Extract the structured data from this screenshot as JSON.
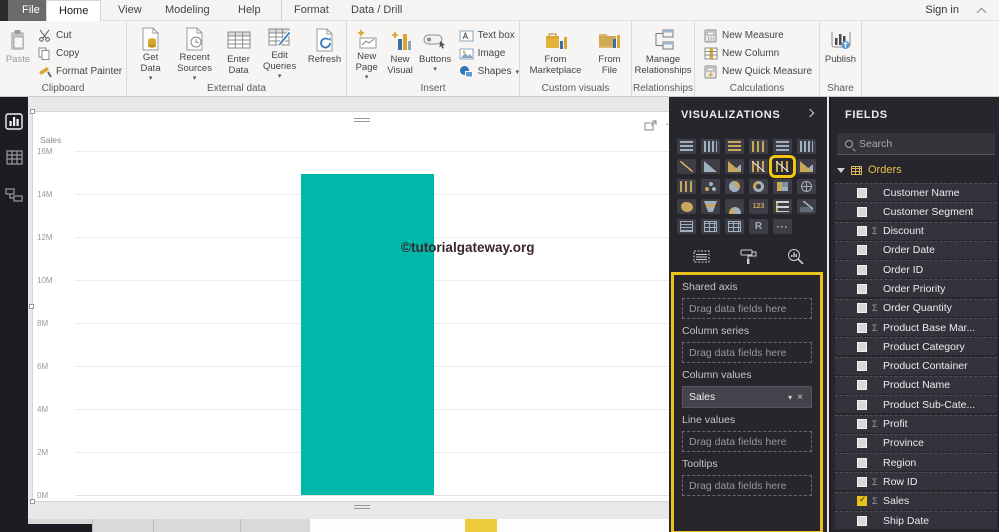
{
  "app": {
    "sign_in": "Sign in"
  },
  "ribbon": {
    "tabs": [
      "File",
      "Home",
      "View",
      "Modeling",
      "Help",
      "Format",
      "Data / Drill"
    ],
    "active_tab": "Home",
    "clipboard": {
      "label": "Clipboard",
      "paste": "Paste",
      "cut": "Cut",
      "copy": "Copy",
      "format_painter": "Format Painter"
    },
    "external_data": {
      "label": "External data",
      "get_data": "Get Data",
      "recent_sources": "Recent Sources",
      "enter_data": "Enter Data",
      "edit_queries": "Edit Queries",
      "refresh": "Refresh"
    },
    "insert": {
      "label": "Insert",
      "new_page": "New Page",
      "new_visual": "New Visual",
      "buttons": "Buttons",
      "text_box": "Text box",
      "image": "Image",
      "shapes": "Shapes"
    },
    "custom_visuals": {
      "label": "Custom visuals",
      "from_marketplace": "From Marketplace",
      "from_file": "From File"
    },
    "relationships": {
      "label": "Relationships",
      "manage_relationships": "Manage Relationships"
    },
    "calculations": {
      "label": "Calculations",
      "new_measure": "New Measure",
      "new_column": "New Column",
      "new_quick_measure": "New Quick Measure"
    },
    "share": {
      "label": "Share",
      "publish": "Publish"
    }
  },
  "canvas": {
    "watermark": "©tutorialgateway.org"
  },
  "chart_data": {
    "type": "bar",
    "title": "",
    "categories": [
      ""
    ],
    "series": [
      {
        "name": "Sales",
        "values": [
          14900000
        ]
      }
    ],
    "ylabel": "Sales",
    "ylim": [
      0,
      16000000
    ],
    "yticks": [
      "16M",
      "14M",
      "12M",
      "10M",
      "8M",
      "6M",
      "4M",
      "2M",
      "0M"
    ],
    "grid": true,
    "legend": "none",
    "bar_color": "#00b8a9"
  },
  "visualizations": {
    "title": "VISUALIZATIONS",
    "selected_visual": "line-and-clustered-column-chart",
    "gallery_glyphs": {
      "card": "123",
      "r": "R",
      "more": "···"
    },
    "icons": {
      "caret": "▾",
      "remove": "×",
      "visual_more": "···"
    },
    "wells": [
      {
        "label": "Shared axis",
        "placeholder": "Drag data fields here"
      },
      {
        "label": "Column series",
        "placeholder": "Drag data fields here"
      },
      {
        "label": "Column values",
        "value": "Sales"
      },
      {
        "label": "Line values",
        "placeholder": "Drag data fields here"
      },
      {
        "label": "Tooltips",
        "placeholder": "Drag data fields here"
      }
    ]
  },
  "fields_pane": {
    "title": "FIELDS",
    "search_placeholder": "Search",
    "table_name": "Orders",
    "items": [
      {
        "label": "Customer Name",
        "sigma": "",
        "checked": false
      },
      {
        "label": "Customer Segment",
        "sigma": "",
        "checked": false
      },
      {
        "label": "Discount",
        "sigma": "Σ",
        "checked": false
      },
      {
        "label": "Order Date",
        "sigma": "",
        "checked": false
      },
      {
        "label": "Order ID",
        "sigma": "",
        "checked": false
      },
      {
        "label": "Order Priority",
        "sigma": "",
        "checked": false
      },
      {
        "label": "Order Quantity",
        "sigma": "Σ",
        "checked": false
      },
      {
        "label": "Product Base Mar...",
        "sigma": "Σ",
        "checked": false
      },
      {
        "label": "Product Category",
        "sigma": "",
        "checked": false
      },
      {
        "label": "Product Container",
        "sigma": "",
        "checked": false
      },
      {
        "label": "Product Name",
        "sigma": "",
        "checked": false
      },
      {
        "label": "Product Sub-Cate...",
        "sigma": "",
        "checked": false
      },
      {
        "label": "Profit",
        "sigma": "Σ",
        "checked": false
      },
      {
        "label": "Province",
        "sigma": "",
        "checked": false
      },
      {
        "label": "Region",
        "sigma": "",
        "checked": false
      },
      {
        "label": "Row ID",
        "sigma": "Σ",
        "checked": false
      },
      {
        "label": "Sales",
        "sigma": "Σ",
        "checked": true
      },
      {
        "label": "Ship Date",
        "sigma": "",
        "checked": false
      }
    ]
  },
  "colors": {
    "accent_teal": "#00b8a9",
    "highlight_yellow": "#e9c31a",
    "watermark_text": "#3a2430"
  }
}
